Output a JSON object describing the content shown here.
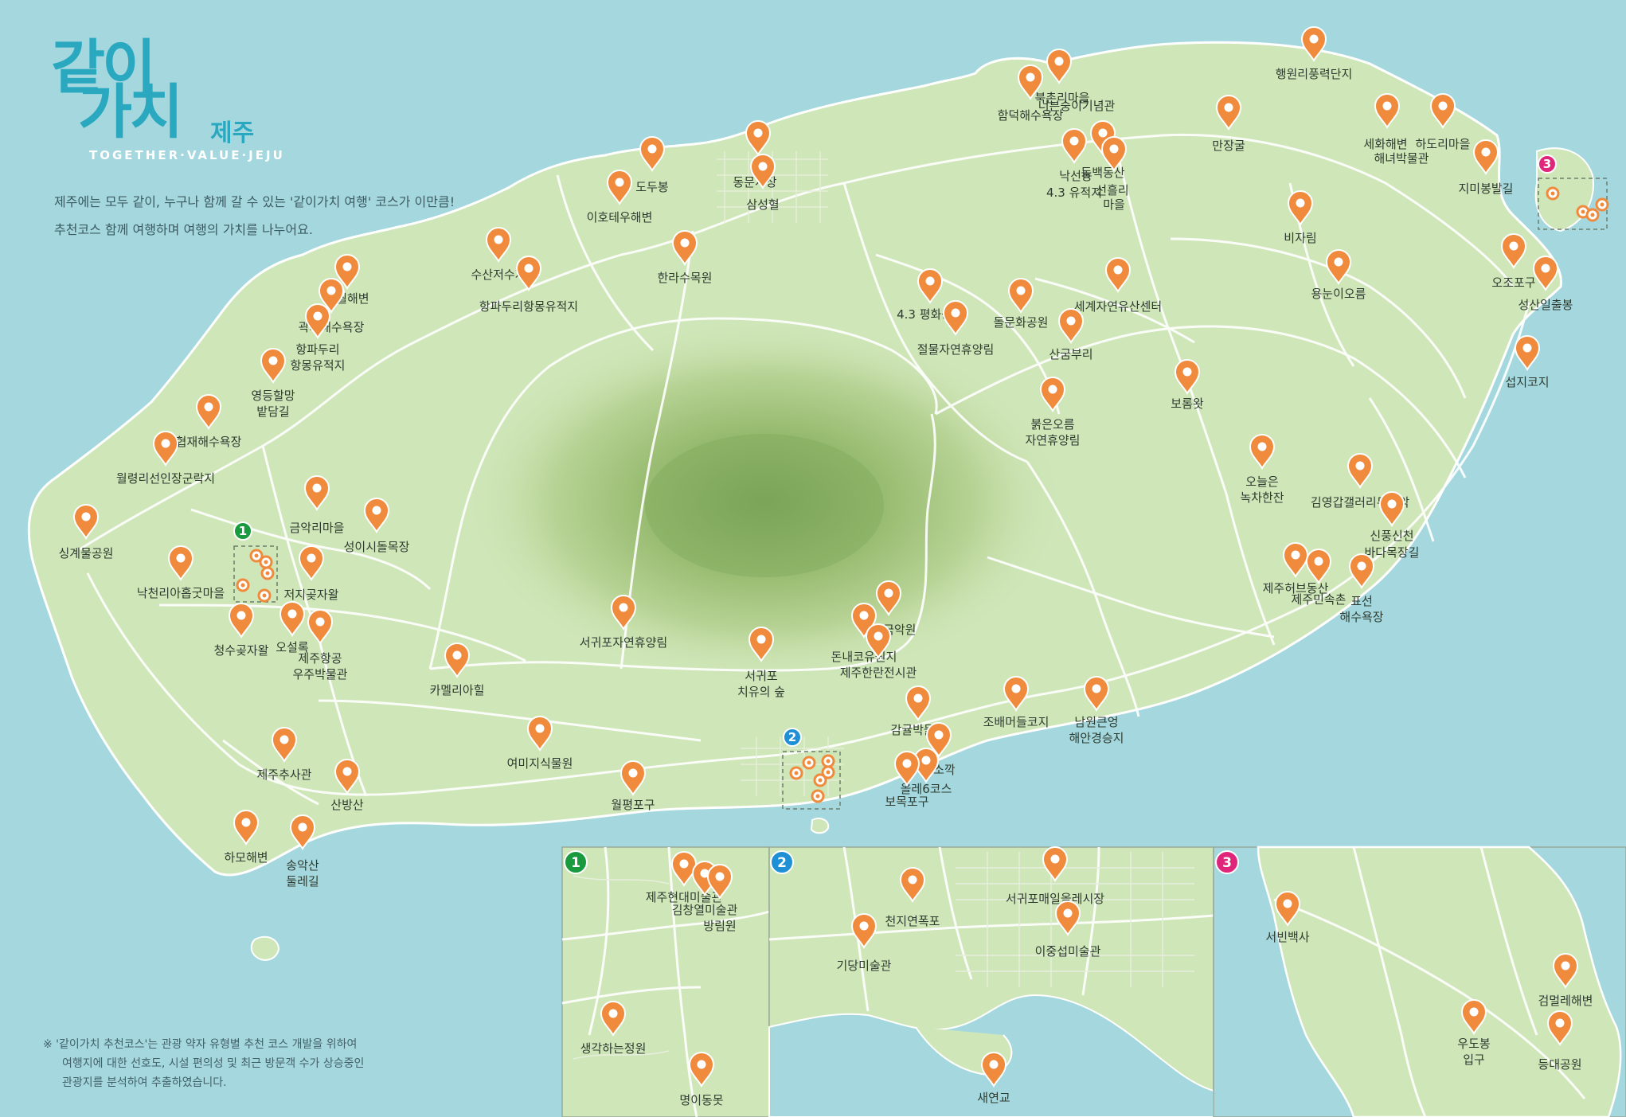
{
  "logo": {
    "main_top": "같이",
    "main_bottom": "가치",
    "sub": "제주",
    "tagline": "TOGETHER·VALUE·JEJU"
  },
  "intro": {
    "line1": "제주에는 모두 같이, 누구나 함께 갈 수 있는 '같이가치 여행' 코스가 이만큼!",
    "line2": "추천코스 함께 여행하며 여행의 가치를 나누어요."
  },
  "footnote": {
    "line1": "※ '같이가치 추천코스'는 관광 약자 유형별 추천 코스 개발을 위하여",
    "line2": "여행지에 대한 선호도, 시설 편의성 및 최근 방문객 수가 상승중인",
    "line3": "관광지를 분석하여 추출하였습니다."
  },
  "colors": {
    "sea": "#a4d8de",
    "land": "#cfe6b8",
    "pin": "#f08a3c",
    "inset1_badge": "#1a9a3e",
    "inset2_badge": "#1f8fd6",
    "inset3_badge": "#e0267a"
  },
  "inset_badges": {
    "b1": "1",
    "b2": "2",
    "b3": "3"
  },
  "places_main": [
    {
      "id": "haengwon",
      "label": "행원리풍력단지"
    },
    {
      "id": "hamdeok",
      "label": "함덕해수욕장"
    },
    {
      "id": "bukchon",
      "label": "북촌리마을"
    },
    {
      "id": "neobeunsungi",
      "label": "너븐숭이기념관"
    },
    {
      "id": "manjanggul",
      "label": "만장굴"
    },
    {
      "id": "sehwa",
      "label": "세화해변"
    },
    {
      "id": "haenyeo",
      "label": "해녀박물관"
    },
    {
      "id": "hado",
      "label": "하도리마을"
    },
    {
      "id": "jimibong",
      "label": "지미봉발길"
    },
    {
      "id": "nakseon",
      "label": "낙선동"
    },
    {
      "id": "yujeokji",
      "label": "4.3 유적지"
    },
    {
      "id": "dongbaek",
      "label": "동백동산"
    },
    {
      "id": "seonheul",
      "label": "선흘리"
    },
    {
      "id": "seonheul2",
      "label": "마을"
    },
    {
      "id": "dumbong",
      "label": "도두봉"
    },
    {
      "id": "dongmun",
      "label": "동문시장"
    },
    {
      "id": "samseong",
      "label": "삼성혈"
    },
    {
      "id": "iho",
      "label": "이호테우해변"
    },
    {
      "id": "bijarim",
      "label": "비자림"
    },
    {
      "id": "suan",
      "label": "수산저수지"
    },
    {
      "id": "hangpadu_n",
      "label": "항파두리항몽유적지"
    },
    {
      "id": "halla_arb",
      "label": "한라수목원"
    },
    {
      "id": "yongnuni",
      "label": "용눈이오름"
    },
    {
      "id": "ojo",
      "label": "오조포구"
    },
    {
      "id": "seongsan",
      "label": "성산일출봉"
    },
    {
      "id": "aewol",
      "label": "애월해변"
    },
    {
      "id": "gwakji",
      "label": "곽지해수욕장"
    },
    {
      "id": "hangpadu_w1",
      "label": "항파두리"
    },
    {
      "id": "hangpadu_w2",
      "label": "항몽유적지"
    },
    {
      "id": "peace43",
      "label": "4.3 평화공원"
    },
    {
      "id": "dolmunhwa",
      "label": "돌문화공원"
    },
    {
      "id": "wnh",
      "label": "세계자연유산센터"
    },
    {
      "id": "jeolmul",
      "label": "절물자연휴양림"
    },
    {
      "id": "sangumburi",
      "label": "산굼부리"
    },
    {
      "id": "seopji",
      "label": "섭지코지"
    },
    {
      "id": "yeongdeung1",
      "label": "영등할망"
    },
    {
      "id": "yeongdeung2",
      "label": "밭담길"
    },
    {
      "id": "hyeopjae",
      "label": "협재해수욕장"
    },
    {
      "id": "bolomwat",
      "label": "보롬왓"
    },
    {
      "id": "wollyeong",
      "label": "월령리선인장군락지"
    },
    {
      "id": "bulgeun1",
      "label": "붉은오름"
    },
    {
      "id": "bulgeun2",
      "label": "자연휴양림"
    },
    {
      "id": "osulloc_tea1",
      "label": "오늘은"
    },
    {
      "id": "osulloc_tea2",
      "label": "녹차한잔"
    },
    {
      "id": "kimyoung",
      "label": "김영갑갤러리두모악"
    },
    {
      "id": "singyemul",
      "label": "싱계물공원"
    },
    {
      "id": "geumak",
      "label": "금악리마을"
    },
    {
      "id": "seongi",
      "label": "성이시돌목장"
    },
    {
      "id": "sinpung1",
      "label": "신풍신천"
    },
    {
      "id": "sinpung2",
      "label": "바다목장길"
    },
    {
      "id": "nakcheon",
      "label": "낙천리아홉굿마을"
    },
    {
      "id": "jeoji",
      "label": "저지곶자왈"
    },
    {
      "id": "heobeok",
      "label": "제주허브동산"
    },
    {
      "id": "minsokchon",
      "label": "제주민속촌"
    },
    {
      "id": "pyoseon1",
      "label": "표선"
    },
    {
      "id": "pyoseon2",
      "label": "해수욕장"
    },
    {
      "id": "cheongsu",
      "label": "청수곶자왈"
    },
    {
      "id": "osulloc",
      "label": "오설록"
    },
    {
      "id": "space1",
      "label": "제주항공"
    },
    {
      "id": "space2",
      "label": "우주박물관"
    },
    {
      "id": "seogwipo_forest",
      "label": "서귀포자연휴양림"
    },
    {
      "id": "camellia",
      "label": "카멜리아힐"
    },
    {
      "id": "healing1",
      "label": "서귀포"
    },
    {
      "id": "healing2",
      "label": "치유의 숲"
    },
    {
      "id": "gukdawon",
      "label": "국립국악원"
    },
    {
      "id": "donnaeko",
      "label": "돈내코유원지"
    },
    {
      "id": "hallaran",
      "label": "제주한란전시관"
    },
    {
      "id": "jobaemeodeul",
      "label": "조배머들코지"
    },
    {
      "id": "namwon1",
      "label": "남원큰엉"
    },
    {
      "id": "namwon2",
      "label": "해안경승지"
    },
    {
      "id": "citrus",
      "label": "감귤박물관"
    },
    {
      "id": "soesokkak",
      "label": "쇠소깍"
    },
    {
      "id": "olle6",
      "label": "올레6코스"
    },
    {
      "id": "bomok",
      "label": "보목포구"
    },
    {
      "id": "yeomiji",
      "label": "여미지식물원"
    },
    {
      "id": "chusa",
      "label": "제주추사관"
    },
    {
      "id": "sanbang",
      "label": "산방산"
    },
    {
      "id": "wolpyeong",
      "label": "월평포구"
    },
    {
      "id": "hamo",
      "label": "하모해변"
    },
    {
      "id": "songaksan1",
      "label": "송악산"
    },
    {
      "id": "songaksan2",
      "label": "둘레길"
    }
  ],
  "places_inset1": [
    {
      "id": "hyundai",
      "label": "제주현대미술관"
    },
    {
      "id": "kimchang",
      "label": "김창열미술관"
    },
    {
      "id": "banglim",
      "label": "방림원"
    },
    {
      "id": "thinking",
      "label": "생각하는정원"
    },
    {
      "id": "myeongi",
      "label": "명이동못"
    }
  ],
  "places_inset2": [
    {
      "id": "olle_market",
      "label": "서귀포매일올레시장"
    },
    {
      "id": "cheonji",
      "label": "천지연폭포"
    },
    {
      "id": "leejungseop",
      "label": "이중섭미술관"
    },
    {
      "id": "gidang",
      "label": "기당미술관"
    },
    {
      "id": "saeyeon",
      "label": "새연교"
    }
  ],
  "places_inset3": [
    {
      "id": "seobin",
      "label": "서빈백사"
    },
    {
      "id": "geommeolle",
      "label": "검멀레해변"
    },
    {
      "id": "udobong1",
      "label": "우도봉"
    },
    {
      "id": "udobong2",
      "label": "입구"
    },
    {
      "id": "lighthouse",
      "label": "등대공원"
    }
  ]
}
